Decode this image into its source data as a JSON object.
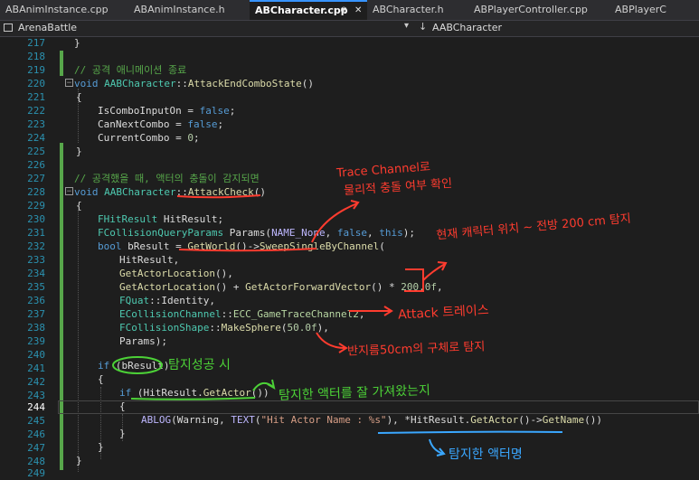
{
  "tabs": [
    {
      "label": "ABAnimInstance.cpp",
      "active": false
    },
    {
      "label": "ABAnimInstance.h",
      "active": false
    },
    {
      "label": "ABCharacter.cpp",
      "active": true,
      "pin": "⊕",
      "close": "✕"
    },
    {
      "label": "ABCharacter.h",
      "active": false
    },
    {
      "label": "ABPlayerController.cpp",
      "active": false
    },
    {
      "label": "ABPlayerC",
      "active": false
    }
  ],
  "nav": {
    "project": "ArenaBattle",
    "dropdown": "▾",
    "class_icon": "↓",
    "class": "AABCharacter"
  },
  "line_numbers": [
    "217",
    "218",
    "219",
    "220",
    "221",
    "222",
    "223",
    "224",
    "225",
    "226",
    "227",
    "228",
    "229",
    "230",
    "231",
    "232",
    "233",
    "234",
    "235",
    "236",
    "237",
    "238",
    "239",
    "240",
    "241",
    "242",
    "243",
    "244",
    "245",
    "246",
    "247",
    "248",
    "249"
  ],
  "current_line": "244",
  "code": {
    "l217": "}",
    "l219_comment": "// 공격 애니메이션 종료",
    "l220_kw": "void",
    "l220_class": "AABCharacter",
    "l220_sep": "::",
    "l220_fn": "AttackEndComboState",
    "l220_tail": "()",
    "l221": "{",
    "l222_var": "IsComboInputOn",
    "l222_eq": " = ",
    "l222_val": "false",
    "l222_end": ";",
    "l223_var": "CanNextCombo",
    "l223_eq": " = ",
    "l223_val": "false",
    "l223_end": ";",
    "l224_var": "CurrentCombo",
    "l224_eq": " = ",
    "l224_val": "0",
    "l224_end": ";",
    "l225": "}",
    "l227_comment": "// 공격했을 때, 액터의 충돌이 감지되면",
    "l228_kw": "void",
    "l228_class": "AABCharacter",
    "l228_sep": "::",
    "l228_fn": "AttackCheck",
    "l228_tail": "()",
    "l229": "{",
    "l230_type": "FHitResult",
    "l230_rest": " HitResult;",
    "l231_type": "FCollisionQueryParams",
    "l231_a": " Params(",
    "l231_macro": "NAME_None",
    "l231_b": ", ",
    "l231_false": "false",
    "l231_c": ", ",
    "l231_this": "this",
    "l231_d": ");",
    "l232_kw": "bool",
    "l232_a": " bResult = ",
    "l232_fn1": "GetWorld",
    "l232_b": "()->",
    "l232_fn2": "SweepSingleByChannel",
    "l232_c": "(",
    "l233": "HitResult,",
    "l234_fn": "GetActorLocation",
    "l234_rest": "(),",
    "l235_fn1": "GetActorLocation",
    "l235_a": "() + ",
    "l235_fn2": "GetActorForwardVector",
    "l235_b": "() * ",
    "l235_num": "200.0f",
    "l235_c": ",",
    "l236_type": "FQuat",
    "l236_sep": "::",
    "l236_member": "Identity",
    "l236_end": ",",
    "l237_type": "ECollisionChannel",
    "l237_sep": "::",
    "l237_enum": "ECC_GameTraceChannel2",
    "l237_end": ",",
    "l238_type": "FCollisionShape",
    "l238_sep": "::",
    "l238_fn": "MakeSphere",
    "l238_a": "(",
    "l238_num": "50.0f",
    "l238_b": "),",
    "l239": "Params);",
    "l241_kw": "if",
    "l241_rest": " (bResult)",
    "l242": "{",
    "l243_kw": "if",
    "l243_a": " (HitResult.",
    "l243_fn": "GetActor",
    "l243_b": "())",
    "l244": "{",
    "l245_macro": "ABLOG",
    "l245_a": "(Warning, ",
    "l245_macro2": "TEXT",
    "l245_b": "(",
    "l245_str": "\"Hit Actor Name : %s\"",
    "l245_c": "), *HitResult.",
    "l245_fn1": "GetActor",
    "l245_d": "()->",
    "l245_fn2": "GetName",
    "l245_e": "())",
    "l246": "}",
    "l247": "}",
    "l248": "}"
  },
  "annotations": {
    "trace_channel": "Trace Channel로",
    "physical_collision": "물리적 충돌 여부 확인",
    "current_position": "현재 캐릭터 위치 ~ 전방 200 cm 탐지",
    "attack_trace": "Attack 트레이스",
    "sphere": "반지름50cm의 구체로 탐지",
    "detect_success": "탐지성공 시",
    "got_actor": "탐지한 액터를 잘 가져왔는지",
    "actor_name": "탐지한 액터명"
  },
  "colors": {
    "annotation_red": "#ff3c2f",
    "annotation_green": "#4cd137",
    "annotation_blue": "#3aa7ff",
    "fold_bar": "#57a64a"
  }
}
